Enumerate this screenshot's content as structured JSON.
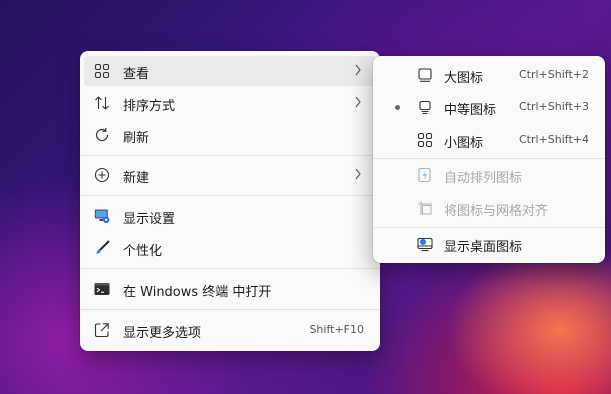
{
  "main_menu": {
    "items": [
      {
        "label": "查看",
        "icon": "grid-icon"
      },
      {
        "label": "排序方式",
        "icon": "sort-icon"
      },
      {
        "label": "刷新",
        "icon": "refresh-icon"
      },
      {
        "label": "新建",
        "icon": "add-circle-icon"
      },
      {
        "label": "显示设置",
        "icon": "display-settings-icon"
      },
      {
        "label": "个性化",
        "icon": "brush-icon"
      },
      {
        "label": "在 Windows 终端 中打开",
        "icon": "terminal-icon"
      },
      {
        "label": "显示更多选项",
        "icon": "open-external-icon",
        "shortcut": "Shift+F10"
      }
    ]
  },
  "sub_menu": {
    "items": [
      {
        "label": "大图标",
        "icon": "large-icons-icon",
        "shortcut": "Ctrl+Shift+2"
      },
      {
        "label": "中等图标",
        "icon": "medium-icons-icon",
        "shortcut": "Ctrl+Shift+3",
        "selected": true
      },
      {
        "label": "小图标",
        "icon": "small-icons-icon",
        "shortcut": "Ctrl+Shift+4"
      },
      {
        "label": "自动排列图标",
        "icon": "auto-arrange-icon",
        "disabled": true
      },
      {
        "label": "将图标与网格对齐",
        "icon": "align-grid-icon",
        "disabled": true
      },
      {
        "label": "显示桌面图标",
        "icon": "show-desktop-icons-icon"
      }
    ]
  },
  "colors": {
    "menu_bg": "#f9f9f9",
    "highlight": "#e9e9e9",
    "accent": "#0078d4"
  }
}
